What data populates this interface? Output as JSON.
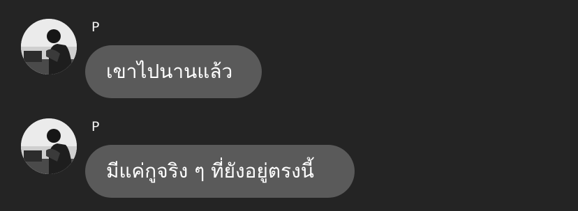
{
  "messages": [
    {
      "sender": "P",
      "avatar_icon": "profile-photo",
      "text": "เขาไปนานแล้ว"
    },
    {
      "sender": "P",
      "avatar_icon": "profile-photo",
      "text": "มีแค่กูจริง ๆ ที่ยังอยู่ตรงนี้"
    }
  ],
  "colors": {
    "background": "#242424",
    "bubble": "#5a5a5a",
    "text": "#ffffff"
  }
}
